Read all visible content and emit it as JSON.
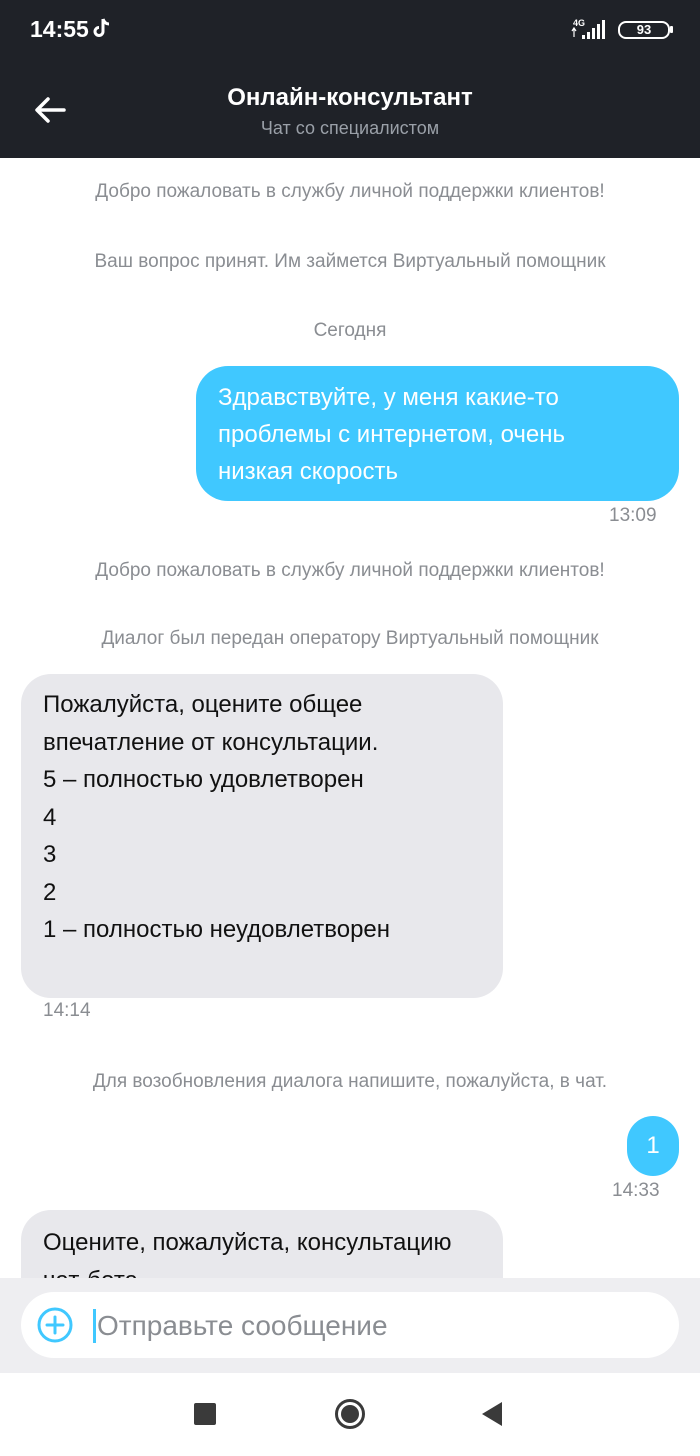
{
  "status_bar": {
    "time": "14:55",
    "network": "4G",
    "battery": "93"
  },
  "header": {
    "title": "Онлайн-консультант",
    "subtitle": "Чат со специалистом"
  },
  "chat": {
    "system_1": "Добро пожаловать в службу личной поддержки клиентов!",
    "system_2": "Ваш вопрос принят. Им займется Виртуальный помощник",
    "date_separator": "Сегодня",
    "msg_1": {
      "lines": [
        "Здравствуйте, у меня какие-то",
        "проблемы с интернетом, очень",
        "низкая скорость"
      ],
      "time": "13:09"
    },
    "system_3": "Добро пожаловать в службу личной поддержки клиентов!",
    "system_4": "Диалог был передан оператору Виртуальный помощник",
    "msg_2": {
      "lines": [
        "Пожалуйста, оцените общее",
        "впечатление от консультации.",
        "5 – полностью удовлетворен",
        "4",
        "3",
        "2",
        "1 – полностью неудовлетворен"
      ],
      "time": "14:14"
    },
    "system_5": "Для возобновления диалога напишите, пожалуйста, в чат.",
    "msg_3": {
      "text": "1",
      "time": "14:33"
    },
    "msg_4": {
      "lines": [
        "Оцените, пожалуйста, консультацию",
        "чат-бота"
      ]
    }
  },
  "composer": {
    "placeholder": "Отправьте сообщение"
  },
  "colors": {
    "header_bg": "#1f2228",
    "outgoing_bubble": "#40c8ff",
    "incoming_bubble": "#e8e8ec"
  },
  "icons": [
    "back-arrow-icon",
    "tiktok-icon",
    "signal-icon",
    "battery-icon",
    "add-circle-icon",
    "square-icon",
    "circle-icon",
    "triangle-back-icon"
  ]
}
